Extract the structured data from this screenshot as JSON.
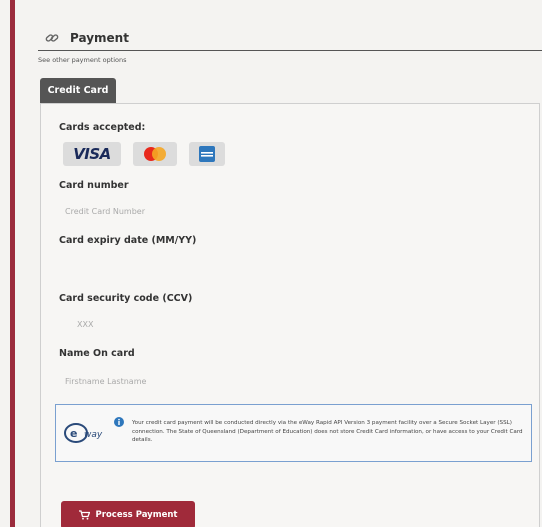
{
  "header": {
    "title": "Payment",
    "icon": "link-icon"
  },
  "other_options_link": "See other payment options",
  "tabs": [
    {
      "label": "Credit Card",
      "active": true
    }
  ],
  "form": {
    "cards_accepted_label": "Cards accepted:",
    "card_logos": {
      "visa": "VISA",
      "others": [
        "mastercard-logo",
        "amex-logo"
      ]
    },
    "card_number": {
      "label": "Card number",
      "placeholder": "Credit Card Number"
    },
    "expiry": {
      "label": "Card expiry date (MM/YY)"
    },
    "security": {
      "label": "Card security code (CCV)",
      "placeholder": "XXX"
    },
    "name": {
      "label": "Name On card",
      "placeholder": "Firstname Lastname"
    }
  },
  "notice": {
    "logo": "eway",
    "text": "Your credit card payment will be conducted directly via the eWay Rapid API Version 3 payment facility over a Secure Socket Layer (SSL) connection. The State of Queensland (Department of Education) does not store Credit Card information, or have access to your Credit Card details."
  },
  "submit": {
    "label": "Process Payment"
  },
  "colors": {
    "accent": "#9b2c3d",
    "button": "#a02a3a",
    "tab": "#555555",
    "notice_border": "#7aa0d0"
  }
}
